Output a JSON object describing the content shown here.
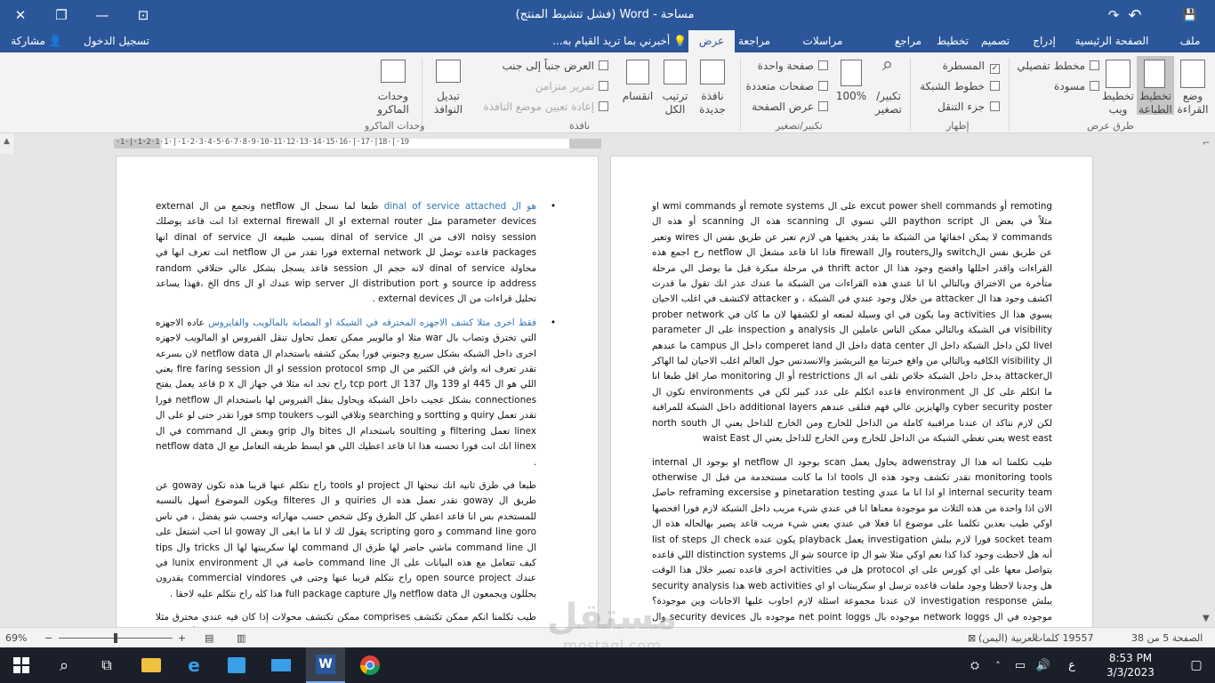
{
  "title_bar": {
    "title": "مساحة - Word (فشل تنشيط المنتج)",
    "close": "✕",
    "restore": "❐",
    "ribbon_display": "⊡",
    "minimize": "—",
    "undo": "↶",
    "redo": "↷",
    "save": "💾"
  },
  "tabs": [
    {
      "label": "ملف"
    },
    {
      "label": "الصفحة الرئيسية"
    },
    {
      "label": "إدراج"
    },
    {
      "label": "تصميم"
    },
    {
      "label": "تخطيط"
    },
    {
      "label": "مراجع"
    },
    {
      "label": "مراسلات"
    },
    {
      "label": "مراجعة"
    },
    {
      "label": "عرض"
    }
  ],
  "tell_me": "أخبرني بما تريد القيام به...",
  "sign_in": "تسجيل الدخول",
  "share": "مشاركة",
  "ribbon": {
    "views_group": "طرق عرض",
    "read_mode": "وضع القراءة",
    "print_layout": "تخطيط الطباعة",
    "web_layout": "تخطيط ويب",
    "outline": "مخطط تفصيلي",
    "draft": "مسودة",
    "show_group": "إظهار",
    "ruler": "المسطرة",
    "gridlines": "خطوط الشبكة",
    "nav_pane": "جزء التنقل",
    "zoom_group": "تكبير/تصغير",
    "zoom": "تكبير/تصغير",
    "zoom_100": "100%",
    "one_page": "صفحة واحدة",
    "multi_page": "صفحات متعددة",
    "page_width": "عرض الصفحة",
    "window_group": "نافذة",
    "new_window": "نافذة جديدة",
    "arrange_all": "ترتيب الكل",
    "split": "انقسام",
    "side_by_side": "العرض جنباً إلى جنب",
    "sync_scroll": "تمرير متزامن",
    "reset_window": "إعادة تعيين موضع النافذة",
    "switch_windows": "تبديل النوافذ",
    "macros_group": "وحدات الماكرو",
    "macros": "وحدات الماكرو"
  },
  "ruler_text": "·1·|·1·2·1·1·|·1·2·3·4·5·6·7·8·9·10·11·12·13·14·15·16·|·17·|18·|·19",
  "page_right": {
    "paragraphs": [
      "remoting أو excut power shell commands على ال remote systems أو wmi commands او مثلاً في بعض ال paython script اللي تسوي ال scanning هذه ال scanning أو هذه ال commands لا يمكن اخفائها من الشبكة ما يقدر يخفيها هي لازم تعبر عن طريق نفس ال wires وتعبر عن طريق نفس الswitch والrouters وال firewall فاذا انا قاعد مشغل ال netflow رح اجمع هذه القراءات واقدر احللها وافضح وجود هذا ال thrift actor في مرحلة مبكرة قبل ما يوصل الي مرحلة متأخرة من الاختراق وبالتالي انا انا عندي هذه القراءات من الشبكة ما عندك عذر انك تقول ما قدرت اكشف وجود هذا ال attacker من خلال وجود عندي في الشبكة ، و attacker لاكتشف في اغلب الاحيان يسوي هذا ال activities وما يكون في اي وسيلة لمنعه او لكشفها لان ما كان في prober network visibility في الشبكة وبالتالي ممكن الناس عاملين ال analysis و inspection على ال parameter livel لكن داخل الشبكة داخل ال data center داخل ال comperet land داخل ال campus ما عندهم ال visibility الكافيه وبالتالي من واقع خبرتنا مع البريشيز والانسدنس حول العالم اغلب الاحيان لما الهاكر الattacker يدخل داخل الشبكة خلاص تلقى انه ال restrictions أو ال monitoring صار اقل طبعا انا ما اتكلم على كل ال environment قاعده اتكلم على عدد كبير لكن في environments تكون ال cyber security poster والهايزين عالي فهم فتلقى عندهم additional layers داخل الشبكة للمراقبة لكن لازم نتاكد ان عندنا مراقبية كاملة من الداخل للخارج ومن الخارج للداخل يعني ال north south west east يعني تغطي الشبكة من الداخل للخارج ومن الخارج للداخل يعني ال waist East",
      "طيب تكلمنا انه هذا ال adwenstray يحاول يعمل scan بوجود ال netflow او بوجود ال internal monitoring tools تقدر تكشف وجود هذه ال tools اذا ما كانت مستخدمة من قبل ال otherwise internal security team او اذا انا ما عندي pinetaration testing و reframing excersise حاصل الان اذا واحدة من هذه الثلاث مو موجودة معناها انا في عندي شيء مريب داخل الشبكة لازم فورا افحصها اوكي طيب بعدين تكلمنا على موضوع انا فعلا في عندي يعني شيء مريب قاعد يصير بهالحاله هذه ال socket team فورا لازم يبلش investigation يعمل playback يكون عنده check ال list of steps أنه هل لاحظت وجود كذا كذا نعم اوكي مثلا شو ال source ip شو ال distinction systems اللي قاعده يتواصل معها على اي كورس على اي protocol هل في activities اخرى قاعده تصير خلال هذا الوقت هل وجدنا لاحظنا وجود ملفات قاعده ترسل او سكريبتات او اي web activities هذا security analysis يبلش investigation response لان عندنا مجموعة اسئلة لازم اجاوب عليها الاجابات وين موجودة؟ موجوده في ال network loggs موجوده بال net point loggs موجوده بال security devices وال في اخره لازم يكون عندك loggs وال environment تكون مهيئه تهيئه يعني بشكل كامل لتوفير الاجابات"
    ]
  },
  "page_left": {
    "bullets": [
      {
        "lead": "هو ال dinal of service attached",
        "text": " طبعا لما نسجل ال netflow ونجمع من ال external parameter devices مثل external router او ال external firewall اذا انت قاعد يوصلك noisy session الاف من ال dinal of service بسبب طبيعة ال dinal of service انها packages قاعده توصل لل external network فورا تقدر من ال netflow انت تعرف انها في محاولة dinal of service لانه حجم ال session قاعد يسجل بشكل عالي حتلاقي random source ip address و distribution port ال wip server عندك او ال dns الخ ،فهذا يساعد تحليل قراءات من ال external devices ."
      },
      {
        "lead": "فقط اخرى مثلا كشف الاجهزه المخترقه في الشبكة او المصابة بالمالويب والفايروس",
        "text": " عاده الاجهزه التي تخترق وتصاب بال war مثلا او مالويبر ممكن تعمل تحاول تنقل الفيروس او المالويب لاجهزه اخرى داخل الشبكه بشكل سريع وجنوني فورا يمكن كشفه باستخدام ال netflow data لان بسرعه تقدر تعرف انه واش في الكثير من ال session protocol smp او ال fire faring session يعني اللي هو ال 445 او 139 وال 137 ال tcp port راح تجد انه مثلا في جهاز ال p x قاعد يعمل يفتح connectiones بشكل عجيب داخل الشبكة ويحاول ينقل الفيروس لها باستخدام ال netflow فورا تقدر تعمل quiry و sortting و searching وتلاقي التوب smp toukers فورا تقدر حتى لو على ال linex تعمل filtering و soulting باستخدام ال bites وال grip وبعض ال command في ال linex انك انت فورا تحسنه هذا انا قاعد اعطيك اللي هو ابسط طريقه التعامل مع ال netflow data ."
      }
    ],
    "paragraphs": [
      "طبعا في طرق ثانيه انك تبحثها ال project او tools راح نتكلم عنها قريبا هذه تكون goway عن طريق ال goway تقدر تعمل هذه ال quiries و ال filteres ويكون الموضوع أسهل بالنسبه للمستخدم بس انا قاعد اعطي كل الطرق وكل شخص حسب مهاراته وحسب شو يفضل ، في ناس command line goro و scripting goro يقول لك لا انا ما ابغى ال goway انا احب اشتغل على ال command line ماشي حاضر لها طرق ال command لها سكريبتها لها ال tricks وال tips كيف تتعامل مع هذه البيانات على ال command line خاصة في ال lunix environment في عندك open source project راح نتكلم قريبا عنها وحتى في commercial vindores يقدرون يحللون ويجمعون ال netflow data وال full package capture هذا كله راح نتكلم عليه لاحقا .",
      "طيب تكلمنا انكم ممكن تكتشف comprises ممكن تكتشف محولات إذا كان فيه عندي مخترق مثلا human attacker اخترق جهاز في الشبكة ويحاول ينتقل من هذا الجهاز الي شبكات أخرى و v lands و sigment أخرى داخل الشبكة ف من ضمن التكتيكات أنه يعمل internal records يعني scanning داخل الشبكة ويجمع معلومات ليعرف هو وين موجود حاليا وين ال active directory وين ال exchange وين ال"
    ]
  },
  "status": {
    "page": "الصفحة 5 من 38",
    "words": "19557 كلمات",
    "language": "العربية (اليمن)",
    "zoom": "69%"
  },
  "taskbar": {
    "lang": "ع",
    "time": "8:53 PM",
    "date": "3/3/2023"
  },
  "watermark": {
    "text": "مستقل",
    "url": "mostaql.com"
  },
  "colors": {
    "word_blue": "#2b579a",
    "ribbon_bg": "#f3f3f3",
    "taskbar": "#1b1f2a",
    "link_blue": "#2e74b5"
  }
}
